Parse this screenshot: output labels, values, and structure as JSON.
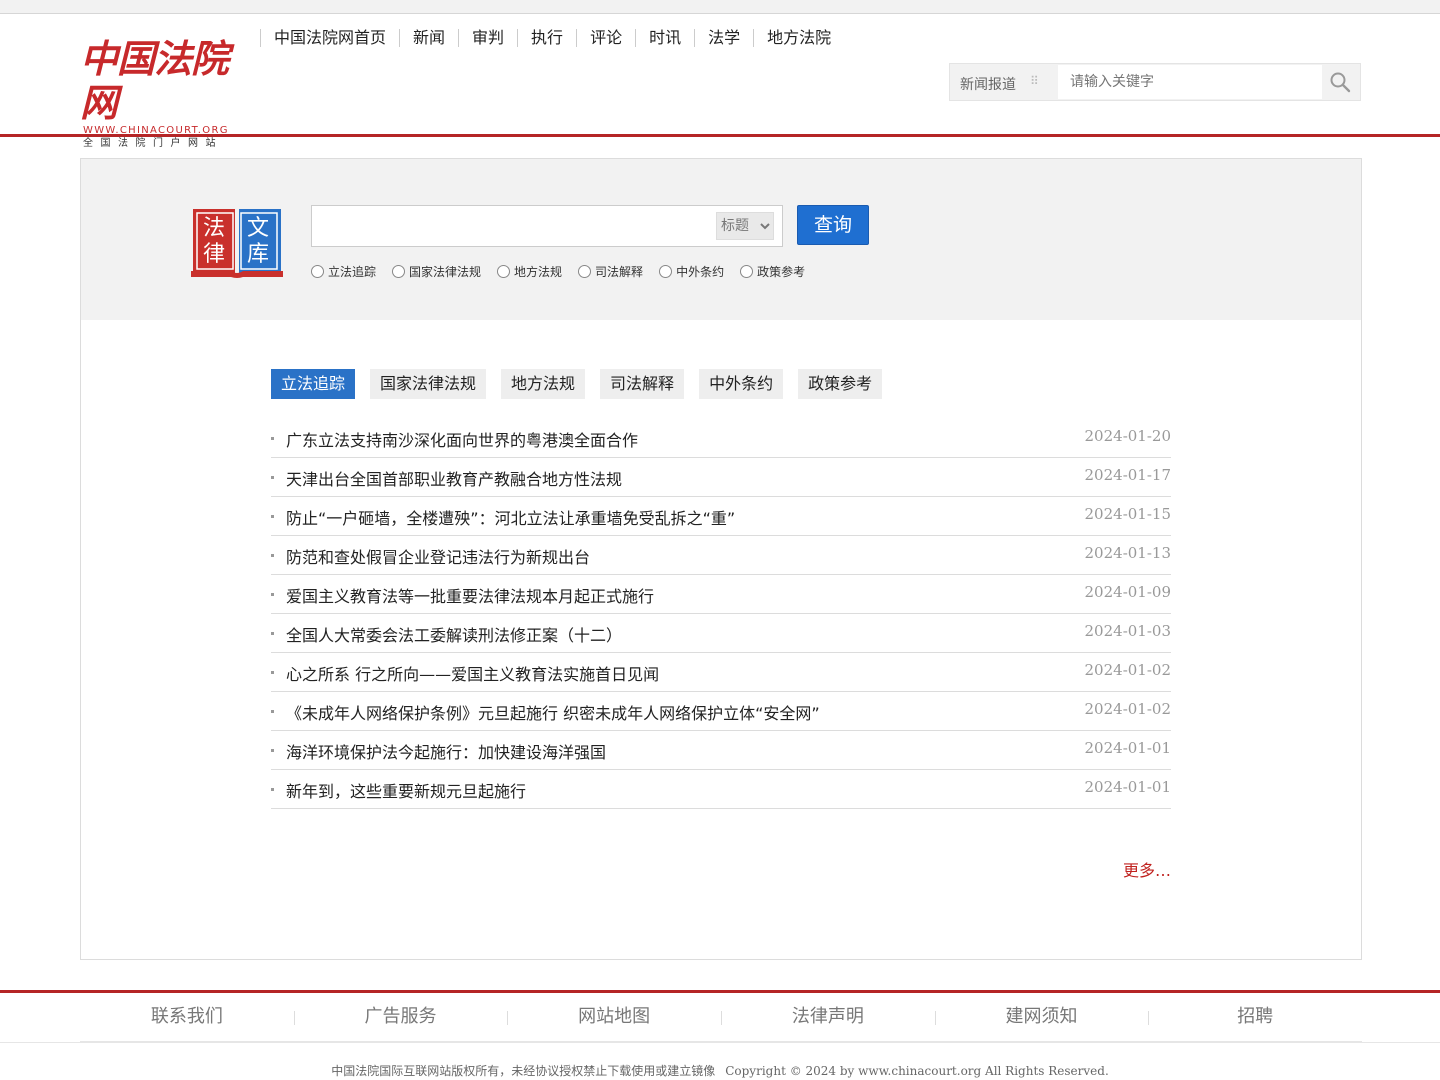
{
  "logo": {
    "name": "中国法院网",
    "url": "WWW.CHINACOURT.ORG",
    "tagline": "全国法院门户网站"
  },
  "nav": [
    "中国法院网首页",
    "新闻",
    "审判",
    "执行",
    "评论",
    "时讯",
    "法学",
    "地方法院"
  ],
  "site_search": {
    "category": "新闻报道",
    "separator": "⠿",
    "placeholder": "请输入关键字",
    "icon": "search-icon"
  },
  "law_search": {
    "logo_chars": [
      "法",
      "律",
      "文",
      "库"
    ],
    "query_value": "",
    "field_selected": "标题",
    "button_label": "查询",
    "radios": [
      "立法追踪",
      "国家法律法规",
      "地方法规",
      "司法解释",
      "中外条约",
      "政策参考"
    ]
  },
  "tabs": [
    "立法追踪",
    "国家法律法规",
    "地方法规",
    "司法解释",
    "中外条约",
    "政策参考"
  ],
  "active_tab": "立法追踪",
  "articles": [
    {
      "title": "广东立法支持南沙深化面向世界的粤港澳全面合作",
      "date": "2024-01-20"
    },
    {
      "title": "天津出台全国首部职业教育产教融合地方性法规",
      "date": "2024-01-17"
    },
    {
      "title": "防止“一户砸墙，全楼遭殃”：河北立法让承重墙免受乱拆之“重”",
      "date": "2024-01-15"
    },
    {
      "title": "防范和查处假冒企业登记违法行为新规出台",
      "date": "2024-01-13"
    },
    {
      "title": "爱国主义教育法等一批重要法律法规本月起正式施行",
      "date": "2024-01-09"
    },
    {
      "title": "全国人大常委会法工委解读刑法修正案（十二）",
      "date": "2024-01-03"
    },
    {
      "title": "心之所系 行之所向——爱国主义教育法实施首日见闻",
      "date": "2024-01-02"
    },
    {
      "title": "《未成年人网络保护条例》元旦起施行 织密未成年人网络保护立体“安全网”",
      "date": "2024-01-02"
    },
    {
      "title": "海洋环境保护法今起施行：加快建设海洋强国",
      "date": "2024-01-01"
    },
    {
      "title": "新年到，这些重要新规元旦起施行",
      "date": "2024-01-01"
    }
  ],
  "more_label": "更多…",
  "footer": {
    "links": [
      "联系我们",
      "广告服务",
      "网站地图",
      "法律声明",
      "建网须知",
      "招聘"
    ],
    "copyright_cn": "中国法院国际互联网站版权所有，未经协议授权禁止下载使用或建立镜像",
    "copyright_en": "Copyright © 2024 by www.chinacourt.org All Rights Reserved."
  },
  "colors": {
    "brand_red": "#b52526",
    "accent_blue": "#2a72c7",
    "more_red": "#c0221f"
  }
}
